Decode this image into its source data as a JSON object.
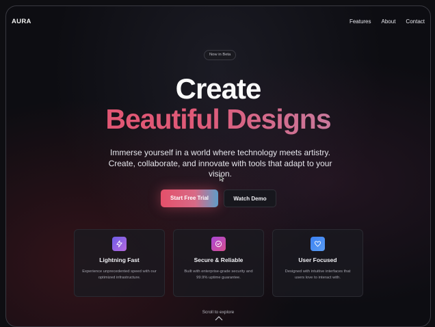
{
  "nav": {
    "logo": "AURA",
    "links": [
      "Features",
      "About",
      "Contact"
    ]
  },
  "hero": {
    "badge": "Now in Beta",
    "title_line1": "Create",
    "title_line2": "Beautiful Designs",
    "subtitle": "Immerse yourself in a world where technology meets artistry. Create, collaborate, and innovate with tools that adapt to your vision.",
    "primary_button": "Start Free Trial",
    "secondary_button": "Watch Demo"
  },
  "features": [
    {
      "icon": "lightning-icon",
      "icon_gradient": [
        "#6d5ce6",
        "#b86adf"
      ],
      "title": "Lightning Fast",
      "description": "Experience unprecedented speed with our optimized infrastructure."
    },
    {
      "icon": "shield-check-icon",
      "icon_gradient": [
        "#a946d6",
        "#d7508f"
      ],
      "title": "Secure & Reliable",
      "description": "Built with enterprise-grade security and 99.9% uptime guarantee."
    },
    {
      "icon": "heart-icon",
      "icon_gradient": [
        "#3b82f6",
        "#5b9cf0"
      ],
      "title": "User Focused",
      "description": "Designed with intuitive interfaces that users love to interact with."
    }
  ],
  "scroll_hint": "Scroll to explore",
  "colors": {
    "accent_pink": "#e4506a",
    "accent_blue": "#5f9cc8",
    "background": "#0d0d12"
  }
}
